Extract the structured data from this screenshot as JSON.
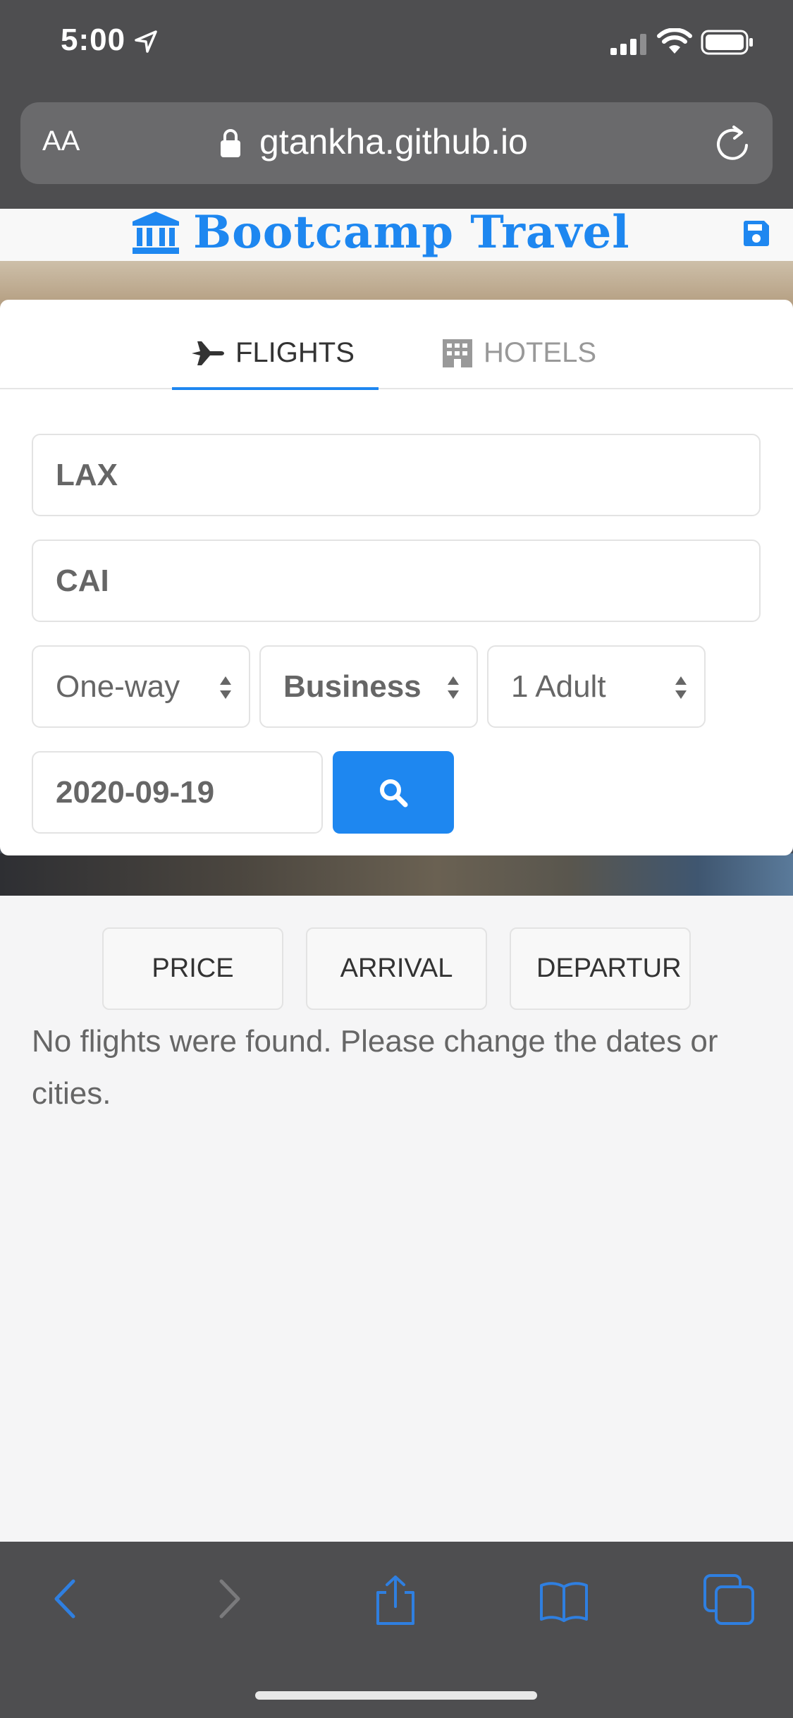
{
  "status_bar": {
    "time": "5:00"
  },
  "browser": {
    "text_size_button": "AA",
    "url": "gtankha.github.io"
  },
  "app": {
    "title": "Bootcamp Travel",
    "accent_color": "#1e87f0"
  },
  "tabs": [
    {
      "label": "FLIGHTS",
      "icon": "plane-icon",
      "active": true
    },
    {
      "label": "HOTELS",
      "icon": "building-icon",
      "active": false
    }
  ],
  "search_form": {
    "origin": "LAX",
    "destination": "CAI",
    "trip_type": "One-way",
    "cabin_class": "Business",
    "passengers": "1 Adult",
    "date": "2020-09-19"
  },
  "sort_buttons": [
    "PRICE",
    "ARRIVAL",
    "DEPARTUR"
  ],
  "results_message": "No flights were found. Please change the dates or cities."
}
